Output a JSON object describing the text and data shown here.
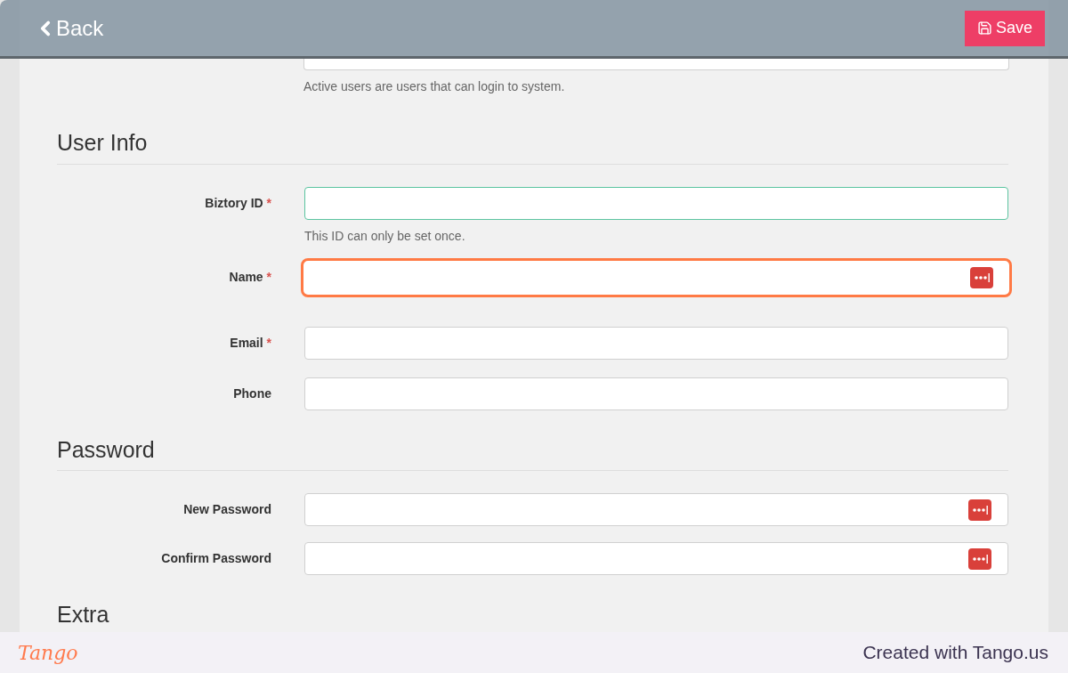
{
  "header": {
    "back": "Back",
    "save": "Save"
  },
  "top_field": {
    "help": "Active users are users that can login to system."
  },
  "required_mark": "*",
  "sections": [
    {
      "title": "User Info",
      "fields": [
        {
          "kind": "text",
          "label": "Biztory ID",
          "required": true,
          "valid": true,
          "focused": false,
          "key_icon": false,
          "help": "This ID can only be set once."
        },
        {
          "kind": "text",
          "label": "Name",
          "required": true,
          "valid": false,
          "focused": true,
          "key_icon": true
        },
        {
          "kind": "text",
          "label": "Email",
          "required": true,
          "valid": false,
          "focused": false,
          "key_icon": false
        },
        {
          "kind": "text",
          "label": "Phone",
          "required": false,
          "valid": false,
          "focused": false,
          "key_icon": false
        }
      ]
    },
    {
      "title": "Password",
      "fields": [
        {
          "kind": "text",
          "label": "New Password",
          "required": false,
          "valid": false,
          "focused": false,
          "key_icon": true
        },
        {
          "kind": "text",
          "label": "Confirm Password",
          "required": false,
          "valid": false,
          "focused": false,
          "key_icon": true
        }
      ]
    },
    {
      "title": "Extra"
    }
  ],
  "footer": {
    "logo": "Tango",
    "credit": "Created with Tango.us"
  }
}
